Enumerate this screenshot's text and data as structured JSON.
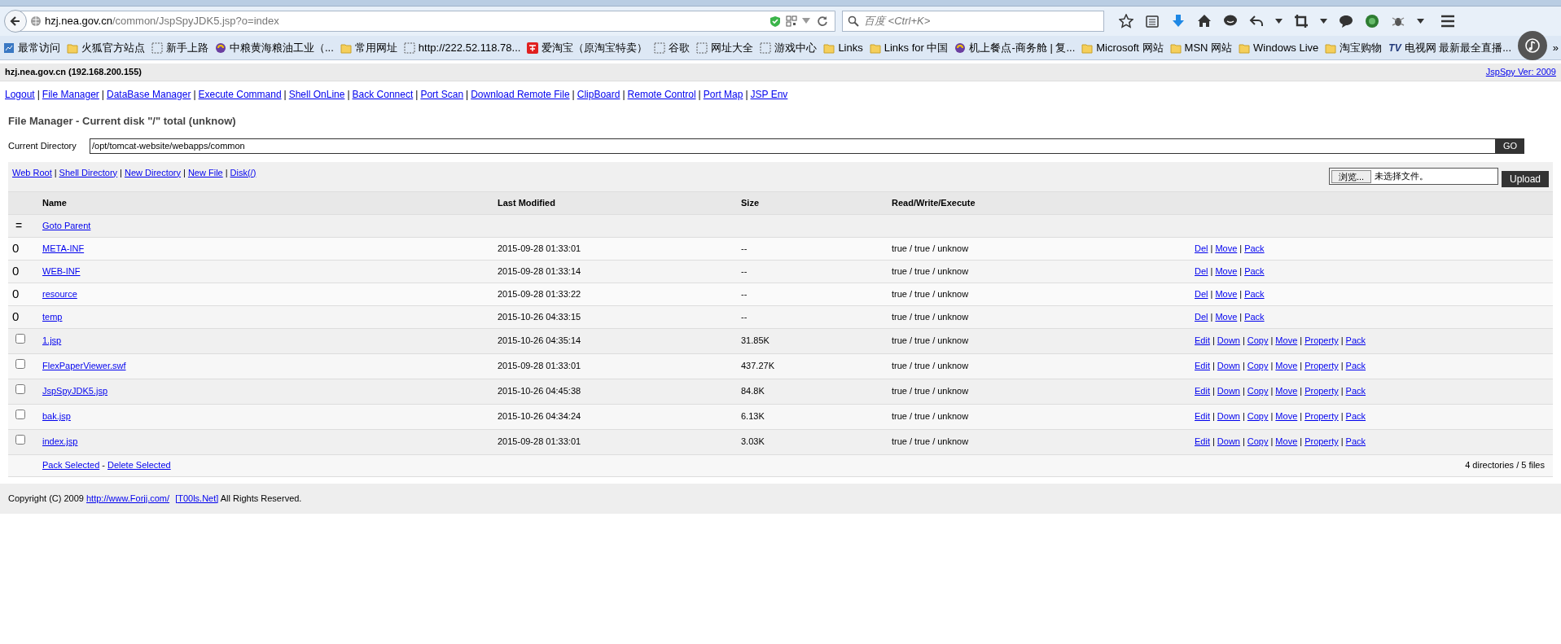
{
  "browser": {
    "url_host": "hzj.nea.gov.cn",
    "url_path": "/common/JspSpyJDK5.jsp?o=index",
    "search_placeholder": "百度 <Ctrl+K>",
    "bookmarks": [
      {
        "label": "最常访问",
        "kind": "page"
      },
      {
        "label": "火狐官方站点",
        "kind": "folder"
      },
      {
        "label": "新手上路",
        "kind": "blank"
      },
      {
        "label": "中粮黄海粮油工业（...",
        "kind": "site"
      },
      {
        "label": "常用网址",
        "kind": "folder"
      },
      {
        "label": "http://222.52.118.78...",
        "kind": "blank"
      },
      {
        "label": "爱淘宝（原淘宝特卖）",
        "kind": "taobao"
      },
      {
        "label": "谷歌",
        "kind": "blank"
      },
      {
        "label": "网址大全",
        "kind": "blank"
      },
      {
        "label": "游戏中心",
        "kind": "blank"
      },
      {
        "label": "Links",
        "kind": "folder"
      },
      {
        "label": "Links for 中国",
        "kind": "folder"
      },
      {
        "label": "机上餐点-商务舱 | 复...",
        "kind": "site"
      },
      {
        "label": "Microsoft 网站",
        "kind": "folder"
      },
      {
        "label": "MSN 网站",
        "kind": "folder"
      },
      {
        "label": "Windows Live",
        "kind": "folder"
      },
      {
        "label": "淘宝购物",
        "kind": "folder"
      },
      {
        "label": "电视网 最新最全直播...",
        "kind": "tv"
      }
    ],
    "tv_logo": "TV",
    "overflow": "»"
  },
  "page": {
    "host": "hzj.nea.gov.cn (192.168.200.155)",
    "version": "JspSpy Ver: 2009",
    "separator": "|",
    "nav": [
      "Logout",
      "File Manager",
      "DataBase Manager",
      "Execute Command",
      "Shell OnLine",
      "Back Connect",
      "Port Scan",
      "Download Remote File",
      "ClipBoard",
      "Remote Control",
      "Port Map",
      "JSP Env"
    ],
    "title": "File Manager - Current disk \"/\" total (unknow)",
    "current_directory": {
      "label": "Current Directory",
      "value": "/opt/tomcat-website/webapps/common",
      "button": "GO"
    },
    "tools": [
      "Web Root",
      "Shell Directory",
      "New Directory",
      "New File",
      "Disk(/)"
    ],
    "file_input": {
      "button": "浏览...",
      "status": "未选择文件。"
    },
    "upload": "Upload",
    "columns": [
      "Name",
      "Last Modified",
      "Size",
      "Read/Write/Execute"
    ],
    "rows": [
      {
        "kind": "parent",
        "marker": "=",
        "name": "Goto Parent"
      },
      {
        "kind": "dir",
        "marker": "0",
        "name": "META-INF",
        "modified": "2015-09-28 01:33:01",
        "size": "--",
        "rwx": "true / true / unknow",
        "actions": [
          "Del",
          "Move",
          "Pack"
        ]
      },
      {
        "kind": "dir",
        "marker": "0",
        "name": "WEB-INF",
        "modified": "2015-09-28 01:33:14",
        "size": "--",
        "rwx": "true / true / unknow",
        "actions": [
          "Del",
          "Move",
          "Pack"
        ]
      },
      {
        "kind": "dir",
        "marker": "0",
        "name": "resource",
        "modified": "2015-09-28 01:33:22",
        "size": "--",
        "rwx": "true / true / unknow",
        "actions": [
          "Del",
          "Move",
          "Pack"
        ]
      },
      {
        "kind": "dir",
        "marker": "0",
        "name": "temp",
        "modified": "2015-10-26 04:33:15",
        "size": "--",
        "rwx": "true / true / unknow",
        "actions": [
          "Del",
          "Move",
          "Pack"
        ]
      },
      {
        "kind": "file",
        "checked": false,
        "name": "1.jsp",
        "modified": "2015-10-26 04:35:14",
        "size": "31.85K",
        "rwx": "true / true / unknow",
        "actions": [
          "Edit",
          "Down",
          "Copy",
          "Move",
          "Property",
          "Pack"
        ]
      },
      {
        "kind": "file",
        "checked": false,
        "name": "FlexPaperViewer.swf",
        "modified": "2015-09-28 01:33:01",
        "size": "437.27K",
        "rwx": "true / true / unknow",
        "actions": [
          "Edit",
          "Down",
          "Copy",
          "Move",
          "Property",
          "Pack"
        ]
      },
      {
        "kind": "file",
        "checked": false,
        "name": "JspSpyJDK5.jsp",
        "modified": "2015-10-26 04:45:38",
        "size": "84.8K",
        "rwx": "true / true / unknow",
        "actions": [
          "Edit",
          "Down",
          "Copy",
          "Move",
          "Property",
          "Pack"
        ]
      },
      {
        "kind": "file",
        "checked": false,
        "name": "bak.jsp",
        "modified": "2015-10-26 04:34:24",
        "size": "6.13K",
        "rwx": "true / true / unknow",
        "actions": [
          "Edit",
          "Down",
          "Copy",
          "Move",
          "Property",
          "Pack"
        ]
      },
      {
        "kind": "file",
        "checked": false,
        "name": "index.jsp",
        "modified": "2015-09-28 01:33:01",
        "size": "3.03K",
        "rwx": "true / true / unknow",
        "actions": [
          "Edit",
          "Down",
          "Copy",
          "Move",
          "Property",
          "Pack"
        ]
      }
    ],
    "bulk": {
      "pack": "Pack Selected",
      "dash": "-",
      "delete": "Delete Selected",
      "summary": "4 directories / 5 files"
    },
    "footer": {
      "prefix": "Copyright (C) 2009",
      "link1": "http://www.Forjj.com/",
      "link2": "[T00ls.Net]",
      "suffix": "All Rights Reserved."
    }
  }
}
